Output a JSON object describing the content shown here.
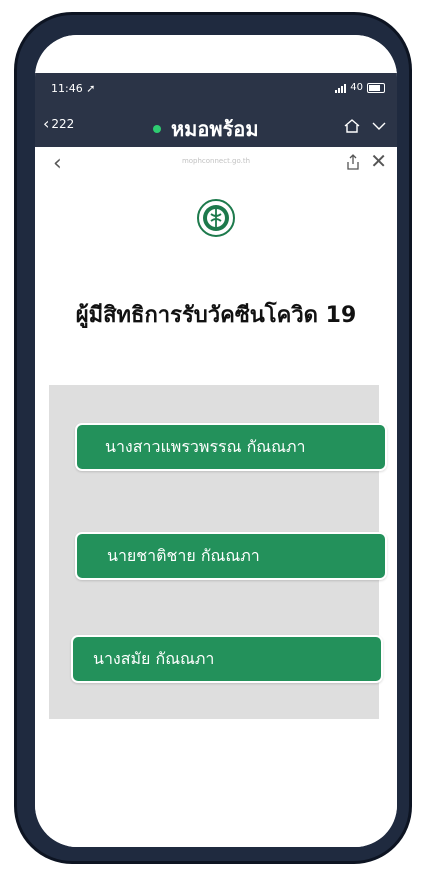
{
  "status": {
    "time": "11:46",
    "right_text": "40"
  },
  "navbar": {
    "back_count": "222",
    "title": "หมอพร้อม"
  },
  "webbar": {
    "url": "mophconnect.go.th"
  },
  "page": {
    "title": "ผู้มีสิทธิการรับวัคซีนโควิด 19"
  },
  "people": [
    {
      "label": "นางสาวแพรวพรรณ กัณณภา"
    },
    {
      "label": "นายชาติชาย กัณณภา"
    },
    {
      "label": "นางสมัย กัณณภา"
    }
  ],
  "colors": {
    "button_green": "#23915b",
    "nav_dark": "#2b3447",
    "panel_gray": "#dedede"
  },
  "icons": [
    "location-arrow-icon",
    "signal-icon",
    "battery-icon",
    "chevron-left-icon",
    "home-icon",
    "chevron-down-icon",
    "share-icon",
    "close-icon",
    "moph-logo"
  ]
}
